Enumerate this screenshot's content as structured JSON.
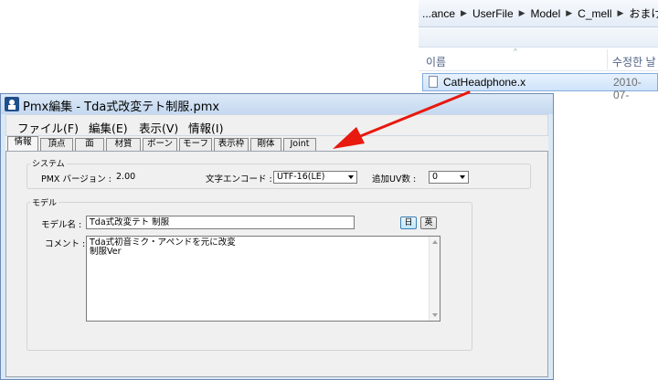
{
  "explorer": {
    "breadcrumb": [
      "...ance",
      "UserFile",
      "Model",
      "C_mell",
      "おまけ"
    ],
    "columns": {
      "name": "이름",
      "modified": "수정한 날"
    },
    "file": {
      "name": "CatHeadphone.x",
      "date": "2010-07-"
    }
  },
  "window": {
    "title": "Pmx編集 - Tda式改変テト制服.pmx",
    "menu": [
      "ファイル(F)",
      "編集(E)",
      "表示(V)",
      "情報(I)"
    ],
    "tabs": [
      "情報",
      "頂点",
      "面",
      "材質",
      "ボーン",
      "モーフ",
      "表示枠",
      "剛体",
      "Joint"
    ],
    "active_tab": "情報"
  },
  "system": {
    "group_label": "システム",
    "pmx_version_label": "PMX バージョン :",
    "pmx_version_value": "2.00",
    "encoding_label": "文字エンコード :",
    "encoding_value": "UTF-16(LE)",
    "add_uv_label": "追加UV数 :",
    "add_uv_value": "0"
  },
  "model": {
    "group_label": "モデル",
    "name_label": "モデル名 :",
    "name_value": "Tda式改変テト 制服",
    "lang_jp": "日",
    "lang_en": "英",
    "comment_label": "コメント :",
    "comment_lines": [
      "Tda式初音ミク・アペンドを元に改変",
      "制服Ver"
    ]
  },
  "colors": {
    "arrow": "#e8190f",
    "title_bg": "#c4d8ef",
    "selection": "#cfe3fb"
  }
}
